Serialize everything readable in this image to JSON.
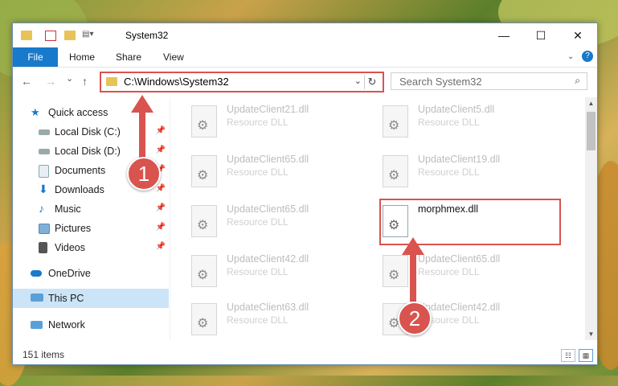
{
  "window": {
    "title": "System32",
    "controls": {
      "minimize": "—",
      "maximize": "☐",
      "close": "✕"
    }
  },
  "ribbon": {
    "tabs": [
      "File",
      "Home",
      "Share",
      "View"
    ]
  },
  "nav": {
    "back": "←",
    "forward": "→",
    "recent": "⌄",
    "up": "↑",
    "address": "C:\\Windows\\System32",
    "search_placeholder": "Search System32"
  },
  "sidebar": {
    "items": [
      {
        "label": "Quick access",
        "icon": "star-icon",
        "pinned": false
      },
      {
        "label": "Local Disk (C:)",
        "icon": "drive-icon",
        "pinned": true
      },
      {
        "label": "Local Disk (D:)",
        "icon": "drive-icon",
        "pinned": true
      },
      {
        "label": "Documents",
        "icon": "documents-icon",
        "pinned": true
      },
      {
        "label": "Downloads",
        "icon": "downloads-icon",
        "pinned": true
      },
      {
        "label": "Music",
        "icon": "music-icon",
        "pinned": true
      },
      {
        "label": "Pictures",
        "icon": "pictures-icon",
        "pinned": true
      },
      {
        "label": "Videos",
        "icon": "videos-icon",
        "pinned": true
      },
      {
        "label": "OneDrive",
        "icon": "onedrive-icon",
        "pinned": false
      },
      {
        "label": "This PC",
        "icon": "computer-icon",
        "pinned": false,
        "selected": true
      },
      {
        "label": "Network",
        "icon": "network-icon",
        "pinned": false
      }
    ]
  },
  "files": [
    {
      "name": "UpdateClient21.dll",
      "type": "Resource DLL"
    },
    {
      "name": "UpdateClient5.dll",
      "type": "Resource DLL"
    },
    {
      "name": "UpdateClient65.dll",
      "type": "Resource DLL"
    },
    {
      "name": "UpdateClient19.dll",
      "type": "Resource DLL"
    },
    {
      "name": "UpdateClient65.dll",
      "type": "Resource DLL"
    },
    {
      "name": "morphmex.dll",
      "type": ""
    },
    {
      "name": "UpdateClient42.dll",
      "type": "Resource DLL"
    },
    {
      "name": "UpdateClient65.dll",
      "type": "Resource DLL"
    },
    {
      "name": "UpdateClient63.dll",
      "type": "Resource DLL"
    },
    {
      "name": "UpdateClient42.dll",
      "type": "Resource DLL"
    }
  ],
  "status": {
    "count": "151 items"
  },
  "annotations": {
    "step1": "1",
    "step2": "2",
    "color": "#d9534f"
  }
}
